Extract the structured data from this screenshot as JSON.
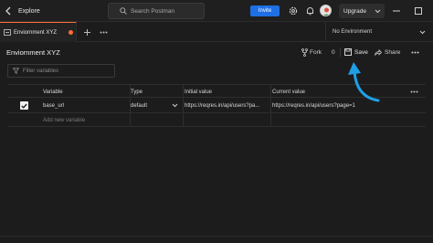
{
  "topbar": {
    "section": "Explore",
    "search_placeholder": "Search Postman",
    "invite_label": "Invite",
    "upgrade_label": "Upgrade"
  },
  "tabs": [
    {
      "label": "Enviornment XYZ",
      "unsaved": true
    }
  ],
  "environment_selector": "No Environment",
  "environment": {
    "title": "Enviornment XYZ",
    "fork_label": "Fork",
    "fork_count": "0",
    "save_label": "Save",
    "share_label": "Share"
  },
  "filter_placeholder": "Filter variables",
  "table": {
    "headers": {
      "variable": "Variable",
      "type": "Type",
      "initial_value": "Initial value",
      "current_value": "Current value"
    },
    "rows": [
      {
        "enabled": true,
        "variable": "base_url",
        "type": "default",
        "initial_value": "https://reqres.in/api/users?pa...",
        "current_value": "https://reqres.in/api/users?page=1"
      }
    ],
    "add_placeholder": "Add new variable"
  },
  "colors": {
    "accent": "#ff6c37",
    "invite": "#1f6fe5",
    "annotation_arrow": "#1fa0e6"
  }
}
